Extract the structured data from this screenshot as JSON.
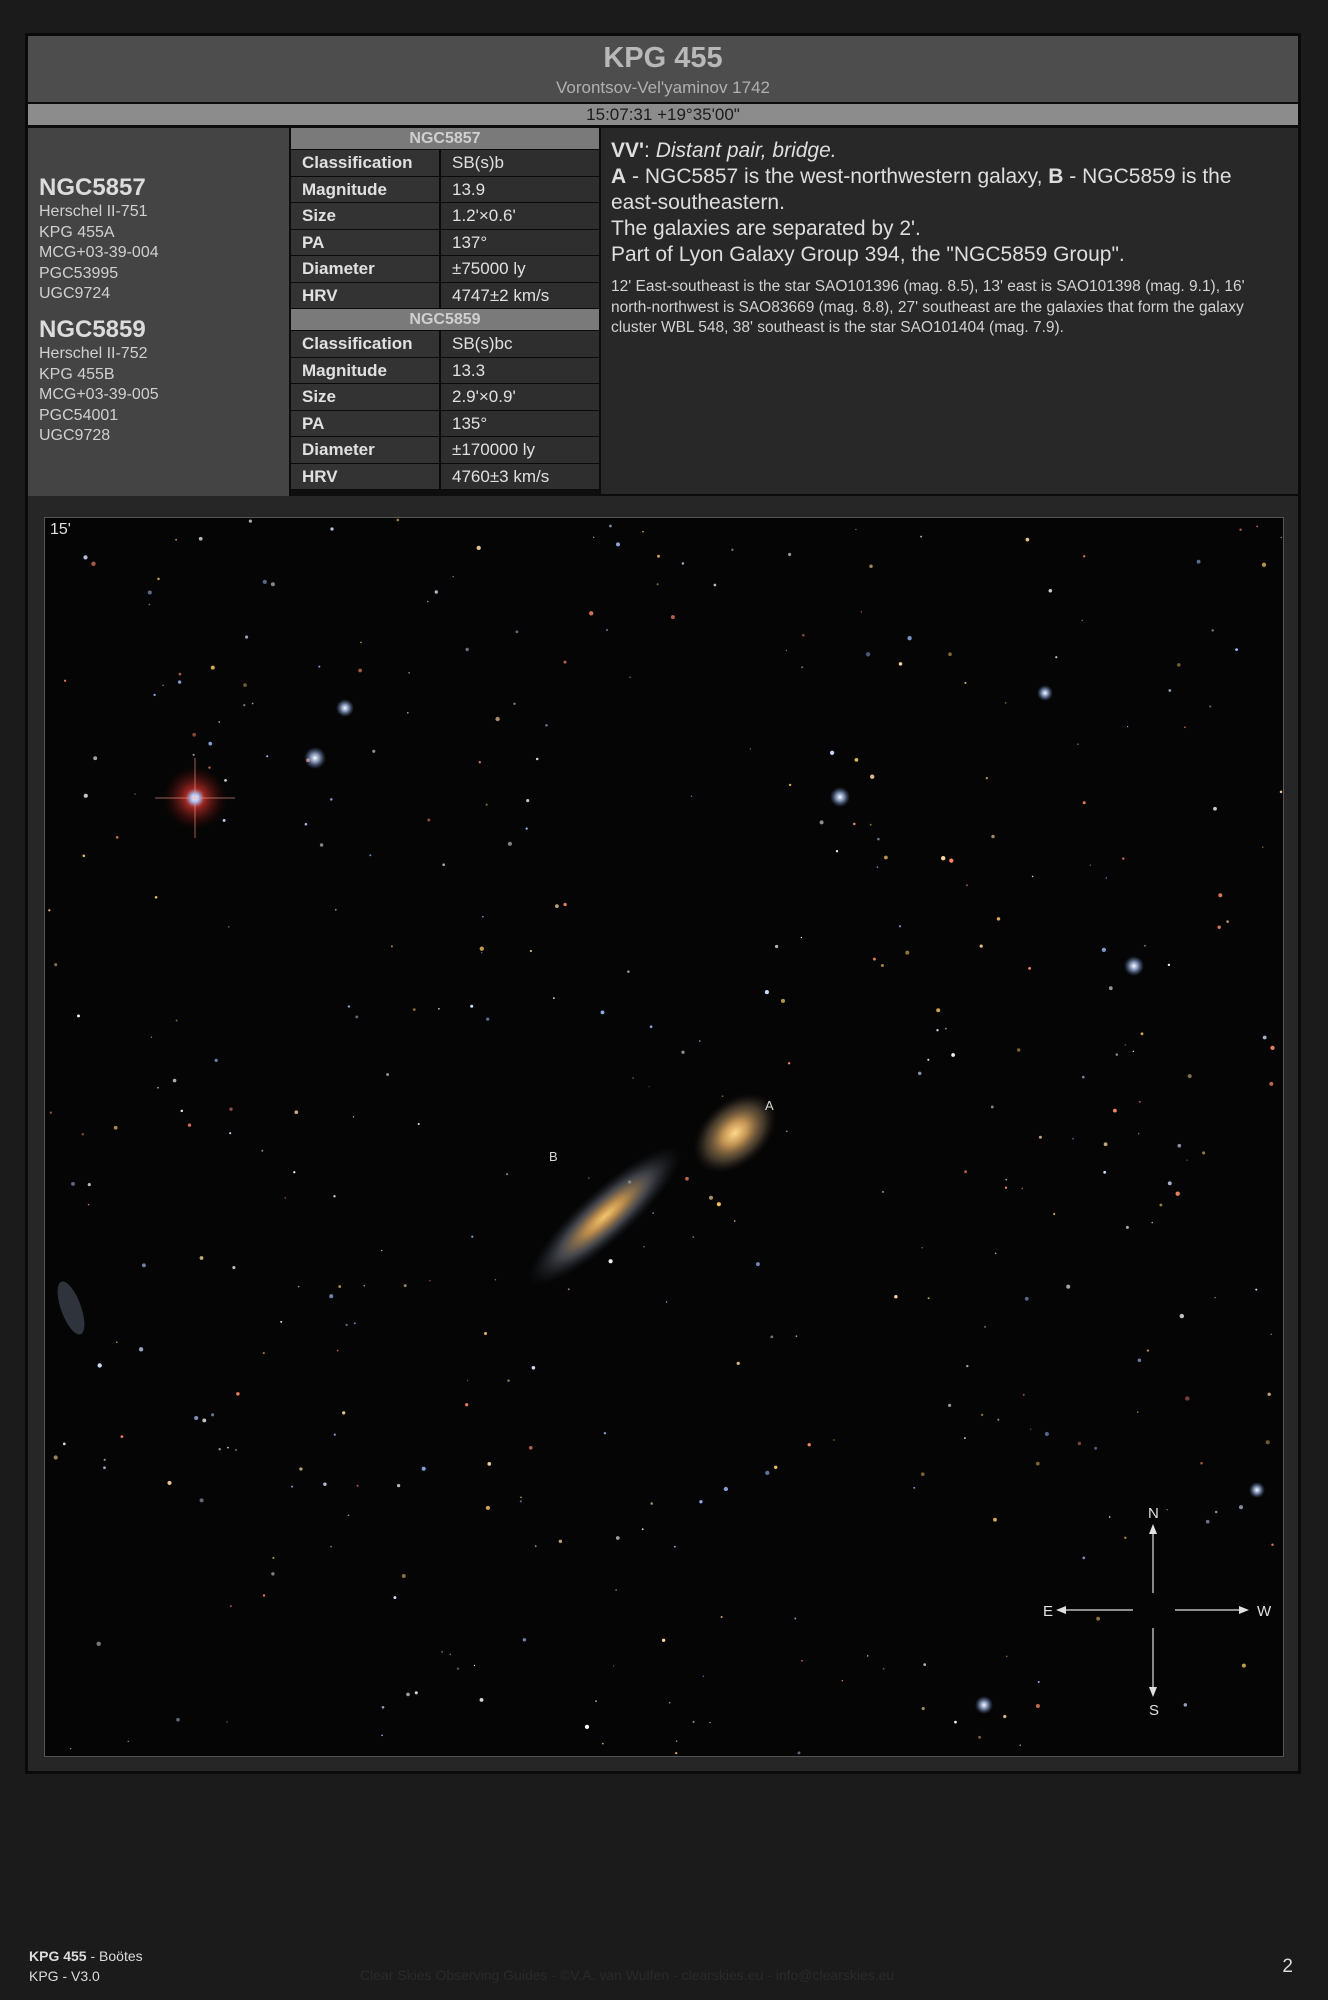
{
  "header": {
    "title": "KPG 455",
    "subtitle": "Vorontsov-Vel'yaminov 1742",
    "coordinates": "15:07:31 +19°35'00\""
  },
  "identifiers": [
    {
      "name": "NGC5857",
      "aliases": [
        "Herschel II-751",
        "KPG 455A",
        "MCG+03-39-004",
        "PGC53995",
        "UGC9724"
      ]
    },
    {
      "name": "NGC5859",
      "aliases": [
        "Herschel II-752",
        "KPG 455B",
        "MCG+03-39-005",
        "PGC54001",
        "UGC9728"
      ]
    }
  ],
  "tables": [
    {
      "header": "NGC5857",
      "rows": [
        {
          "key": "Classification",
          "value": "SB(s)b"
        },
        {
          "key": "Magnitude",
          "value": "13.9"
        },
        {
          "key": "Size",
          "value": "1.2'×0.6'"
        },
        {
          "key": "PA",
          "value": "137°"
        },
        {
          "key": "Diameter",
          "value": "±75000 ly"
        },
        {
          "key": "HRV",
          "value": "4747±2 km/s"
        }
      ]
    },
    {
      "header": "NGC5859",
      "rows": [
        {
          "key": "Classification",
          "value": "SB(s)bc"
        },
        {
          "key": "Magnitude",
          "value": "13.3"
        },
        {
          "key": "Size",
          "value": "2.9'×0.9'"
        },
        {
          "key": "PA",
          "value": "135°"
        },
        {
          "key": "Diameter",
          "value": "±170000 ly"
        },
        {
          "key": "HRV",
          "value": "4760±3 km/s"
        }
      ]
    }
  ],
  "description": {
    "vv_code": "VV'",
    "vv_text": "Distant pair, bridge.",
    "label_a": "A",
    "text_a": " - NGC5857 is the west-northwestern galaxy, ",
    "label_b": "B",
    "text_b": " - NGC5859 is the east-southeastern.",
    "line2": "The galaxies are separated by 2'.",
    "line3": "Part of Lyon Galaxy Group 394, the \"NGC5859 Group\".",
    "note": "12' East-southeast is the star SAO101396 (mag. 8.5), 13' east is SAO101398 (mag. 9.1), 16' north-northwest is SAO83669 (mag. 8.8), 27' southeast are the galaxies that form the galaxy cluster WBL 548, 38' southeast is the star SAO101404 (mag. 7.9)."
  },
  "image": {
    "scale": "15'",
    "label_a": "A",
    "label_b": "B",
    "compass": {
      "n": "N",
      "s": "S",
      "e": "E",
      "w": "W"
    }
  },
  "footer": {
    "title": "KPG 455",
    "constellation": " - Boötes",
    "version": "KPG - V3.0",
    "credit": "Clear Skies Observing Guides - ©V.A. van Wulfen - clearskies.eu - info@clearskies.eu",
    "page": "2"
  }
}
